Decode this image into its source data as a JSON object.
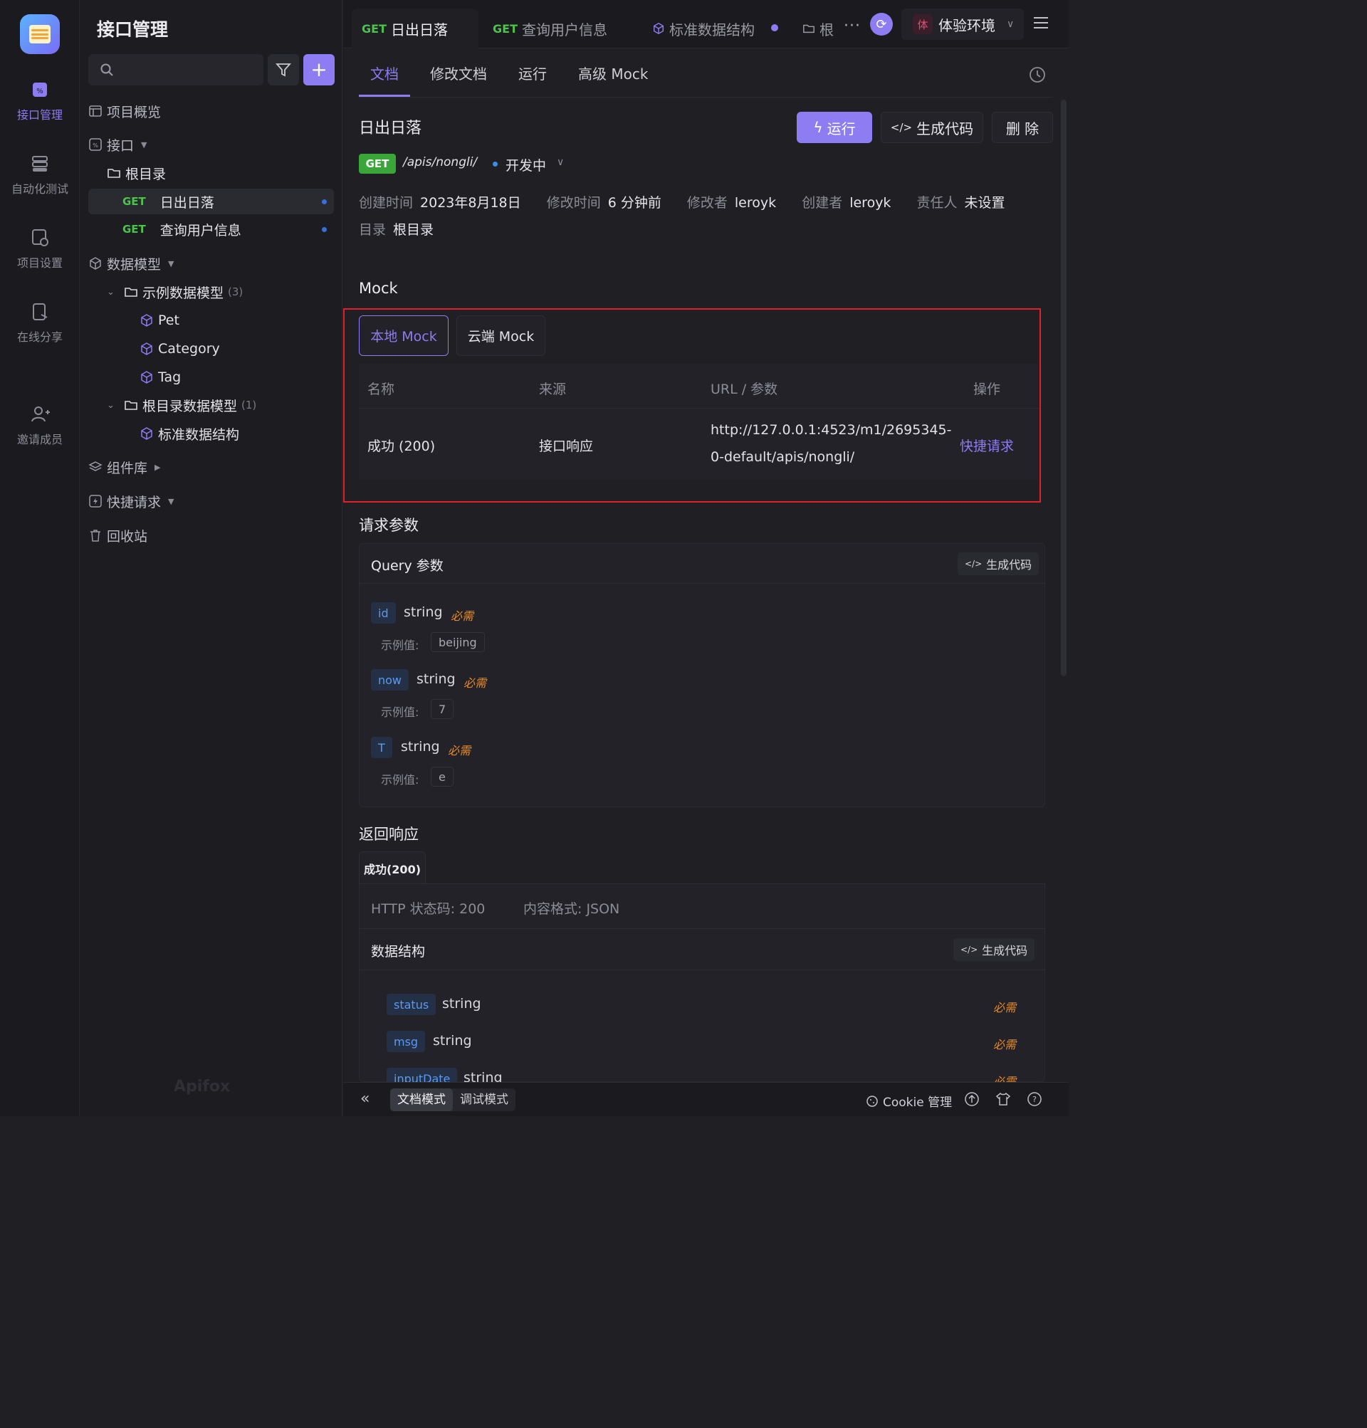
{
  "rail": {
    "items": [
      {
        "label": "接口管理",
        "icon": "api-icon"
      },
      {
        "label": "自动化测试",
        "icon": "automation-icon"
      },
      {
        "label": "项目设置",
        "icon": "settings-icon"
      },
      {
        "label": "在线分享",
        "icon": "share-icon"
      },
      {
        "label": "邀请成员",
        "icon": "invite-user-icon"
      }
    ]
  },
  "sidebar": {
    "title": "接口管理",
    "overview": "项目概览",
    "api_group": "接口",
    "root_folder": "根目录",
    "apis": [
      {
        "method": "GET",
        "name": "日出日落"
      },
      {
        "method": "GET",
        "name": "查询用户信息"
      }
    ],
    "data_models": "数据模型",
    "sample_folder": "示例数据模型",
    "sample_count": "(3)",
    "models": [
      "Pet",
      "Category",
      "Tag"
    ],
    "root_model_folder": "根目录数据模型",
    "root_model_count": "(1)",
    "root_model": "标准数据结构",
    "components": "组件库",
    "quick_request": "快捷请求",
    "trash": "回收站",
    "watermark": "Apifox"
  },
  "tabs": [
    {
      "method": "GET",
      "label": "日出日落"
    },
    {
      "method": "GET",
      "label": "查询用户信息"
    },
    {
      "method": "",
      "label": "标准数据结构"
    },
    {
      "method": "",
      "label": "根"
    }
  ],
  "env": {
    "badge": "体",
    "label": "体验环境"
  },
  "subtabs": [
    "文档",
    "修改文档",
    "运行",
    "高级 Mock"
  ],
  "api": {
    "title": "日出日落",
    "run": "运行",
    "gen_code": "生成代码",
    "delete": "删 除",
    "method": "GET",
    "path": "/apis/nongli/",
    "status": "开发中",
    "created_label": "创建时间",
    "created": "2023年8月18日",
    "modified_label": "修改时间",
    "modified": "6 分钟前",
    "modifier_label": "修改者",
    "modifier": "leroyk",
    "creator_label": "创建者",
    "creator": "leroyk",
    "owner_label": "责任人",
    "owner": "未设置",
    "dir_label": "目录",
    "dir": "根目录"
  },
  "mock": {
    "title": "Mock",
    "tab_local": "本地 Mock",
    "tab_cloud": "云端 Mock",
    "headers": [
      "名称",
      "来源",
      "URL / 参数",
      "操作"
    ],
    "row": {
      "name": "成功 (200)",
      "source": "接口响应",
      "url_line1": "http://127.0.0.1:4523/m1/2695345-",
      "url_line2": "0-default/apis/nongli/",
      "action": "快捷请求"
    }
  },
  "request": {
    "title": "请求参数",
    "query_title": "Query 参数",
    "gen_code": "生成代码",
    "example_label": "示例值:",
    "required": "必需",
    "params": [
      {
        "name": "id",
        "type": "string",
        "example": "beijing"
      },
      {
        "name": "now",
        "type": "string",
        "example": "7"
      },
      {
        "name": "T",
        "type": "string",
        "example": "e"
      }
    ]
  },
  "response": {
    "title": "返回响应",
    "tab": "成功(200)",
    "http_status": "HTTP 状态码: 200",
    "content_type": "内容格式: JSON",
    "struct_title": "数据结构",
    "gen_code": "生成代码",
    "required": "必需",
    "fields": [
      {
        "name": "status",
        "type": "string"
      },
      {
        "name": "msg",
        "type": "string"
      },
      {
        "name": "inputDate",
        "type": "string"
      }
    ]
  },
  "bottom": {
    "doc_mode": "文档模式",
    "debug_mode": "调试模式",
    "cookie": "Cookie 管理"
  },
  "colors": {
    "accent": "#8e7cf2",
    "get": "#4cc34c",
    "required": "#e8892a",
    "highlight_box": "#e0202a"
  }
}
